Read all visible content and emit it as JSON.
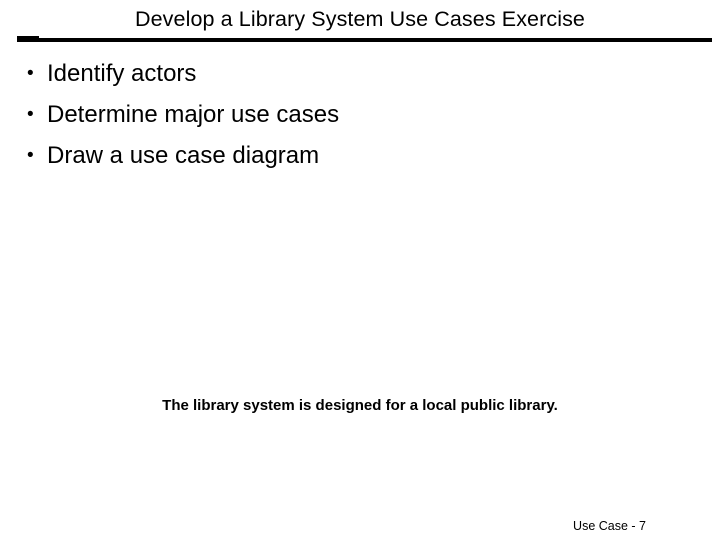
{
  "slide": {
    "title": "Develop a Library System Use Cases Exercise",
    "bullet_marker": "•",
    "bullets": [
      {
        "label": "Identify actors"
      },
      {
        "label": "Determine major use cases"
      },
      {
        "label": "Draw a use case diagram"
      }
    ],
    "statement": "The library system is designed for a local public library.",
    "footer": "Use Case - 7",
    "colors": {
      "text": "#000000",
      "background": "#ffffff",
      "rule": "#000000"
    }
  }
}
